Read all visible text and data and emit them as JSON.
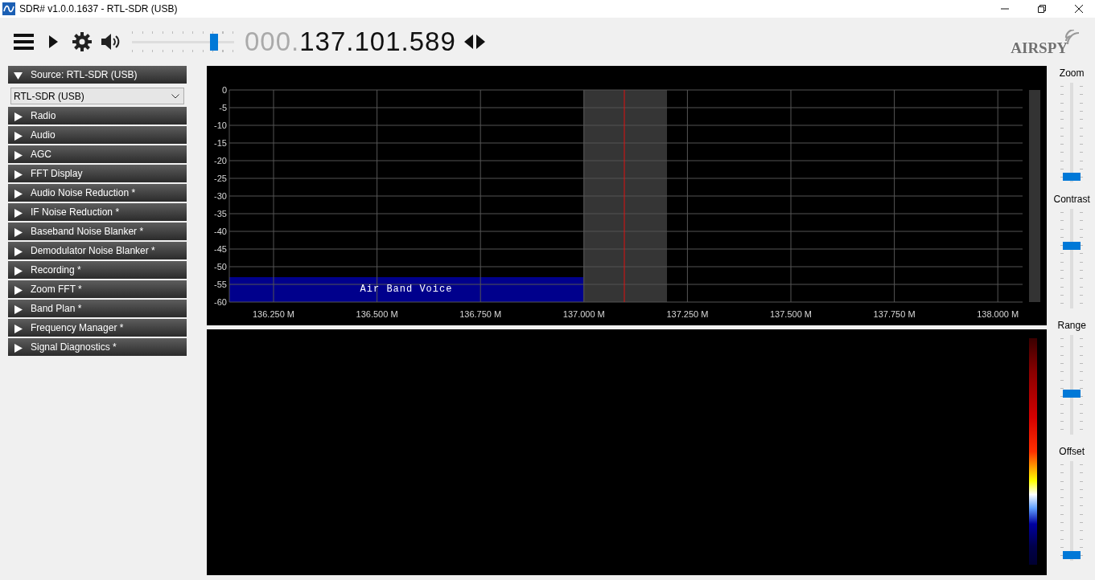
{
  "window": {
    "title": "SDR# v1.0.0.1637 - RTL-SDR (USB)"
  },
  "toolbar": {
    "volume": {
      "level": 0.83
    },
    "frequency_prefix": "000.",
    "frequency": "137.101.589"
  },
  "logo": "AIRSPY",
  "sidebar": {
    "source": {
      "label": "Source: RTL-SDR (USB)",
      "expanded": true,
      "device": "RTL-SDR (USB)"
    },
    "panels": [
      {
        "label": "Radio",
        "expanded": false
      },
      {
        "label": "Audio",
        "expanded": false
      },
      {
        "label": "AGC",
        "expanded": false
      },
      {
        "label": "FFT Display",
        "expanded": false
      },
      {
        "label": "Audio Noise Reduction *",
        "expanded": false
      },
      {
        "label": "IF Noise Reduction *",
        "expanded": false
      },
      {
        "label": "Baseband Noise Blanker *",
        "expanded": false
      },
      {
        "label": "Demodulator Noise Blanker *",
        "expanded": false
      },
      {
        "label": "Recording *",
        "expanded": false
      },
      {
        "label": "Zoom FFT *",
        "expanded": false
      },
      {
        "label": "Band Plan *",
        "expanded": false
      },
      {
        "label": "Frequency Manager *",
        "expanded": false
      },
      {
        "label": "Signal Diagnostics *",
        "expanded": false
      }
    ]
  },
  "spectrum": {
    "y_labels": [
      "0",
      "-5",
      "-10",
      "-15",
      "-20",
      "-25",
      "-30",
      "-35",
      "-40",
      "-45",
      "-50",
      "-55",
      "-60"
    ],
    "x_labels": [
      "136.250 M",
      "136.500 M",
      "136.750 M",
      "137.000 M",
      "137.250 M",
      "137.500 M",
      "137.750 M",
      "138.000 M"
    ],
    "band_label": "Air Band Voice"
  },
  "controls": [
    {
      "label": "Zoom",
      "level": 0.02
    },
    {
      "label": "Contrast",
      "level": 0.64
    },
    {
      "label": "Range",
      "level": 0.4
    },
    {
      "label": "Offset",
      "level": 0.02
    }
  ]
}
